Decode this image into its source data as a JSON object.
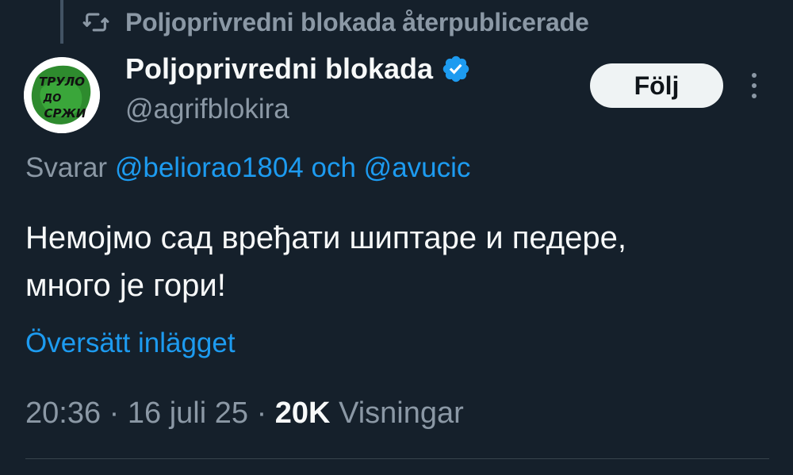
{
  "repost": {
    "text": "Poljoprivredni blokada återpublicerade",
    "icon": "repost-icon"
  },
  "author": {
    "display_name": "Poljoprivredni blokada",
    "handle": "@agrifblokira",
    "verified": true,
    "avatar_icon": "avatar-logo",
    "avatar_text_line1": "ТРУЛО",
    "avatar_text_line2": "ДО",
    "avatar_text_line3": "СРЖИ"
  },
  "actions": {
    "follow_label": "Följ",
    "more_icon": "more-vertical-icon"
  },
  "reply": {
    "prefix": "Svarar",
    "mention1": "@beliorao1804",
    "conjunction": "och",
    "mention2": "@avucic"
  },
  "tweet": {
    "line1": "Немојмо сад вређати шиптаре и педере,",
    "line2": "много је гори!",
    "translate_label": "Översätt inlägget"
  },
  "meta": {
    "time": "20:36",
    "separator": "·",
    "date": "16 juli 25",
    "views_count": "20K",
    "views_label": "Visningar"
  },
  "colors": {
    "background": "#15202b",
    "accent": "#1d9bf0",
    "muted": "#8b98a5",
    "text": "#f7f9f9"
  }
}
